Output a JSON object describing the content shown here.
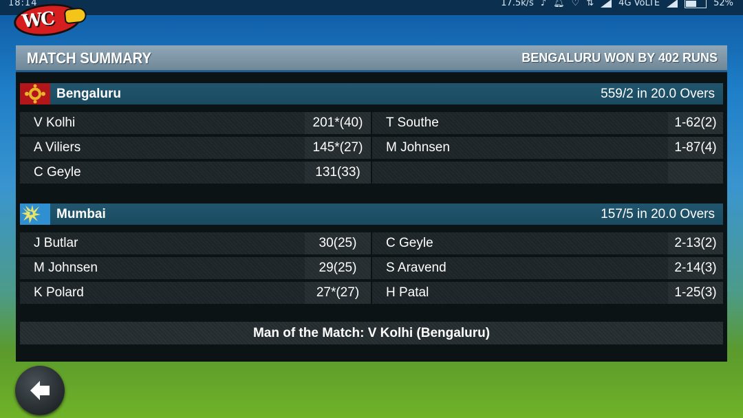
{
  "status_bar": {
    "time": "18:14",
    "speed": "17.5k/s",
    "network": "4G VoLTE",
    "battery": "52%",
    "battery_level": 0.52
  },
  "header": {
    "title": "MATCH SUMMARY",
    "result": "BENGALURU WON BY 402 RUNS"
  },
  "teams": [
    {
      "name": "Bengaluru",
      "score": "559/2 in 20.0 Overs",
      "batting": [
        {
          "name": "V Kolhi",
          "value": "201*(40)"
        },
        {
          "name": "A Viliers",
          "value": "145*(27)"
        },
        {
          "name": "C Geyle",
          "value": "131(33)"
        }
      ],
      "bowling": [
        {
          "name": "T Southe",
          "value": "1-62(2)"
        },
        {
          "name": "M Johnsen",
          "value": "1-87(4)"
        },
        {
          "name": "",
          "value": ""
        }
      ]
    },
    {
      "name": "Mumbai",
      "score": "157/5 in 20.0 Overs",
      "batting": [
        {
          "name": "J Butlar",
          "value": "30(25)"
        },
        {
          "name": "M Johnsen",
          "value": "29(25)"
        },
        {
          "name": "K Polard",
          "value": "27*(27)"
        }
      ],
      "bowling": [
        {
          "name": "C Geyle",
          "value": "2-13(2)"
        },
        {
          "name": "S Aravend",
          "value": "2-14(3)"
        },
        {
          "name": "H Patal",
          "value": "1-25(3)"
        }
      ]
    }
  ],
  "man_of_the_match": "Man of the Match: V Kolhi (Bengaluru)",
  "colors": {
    "panel": "#0c1315",
    "team_bar": "#1a4a60",
    "header": "#7a93a3"
  }
}
